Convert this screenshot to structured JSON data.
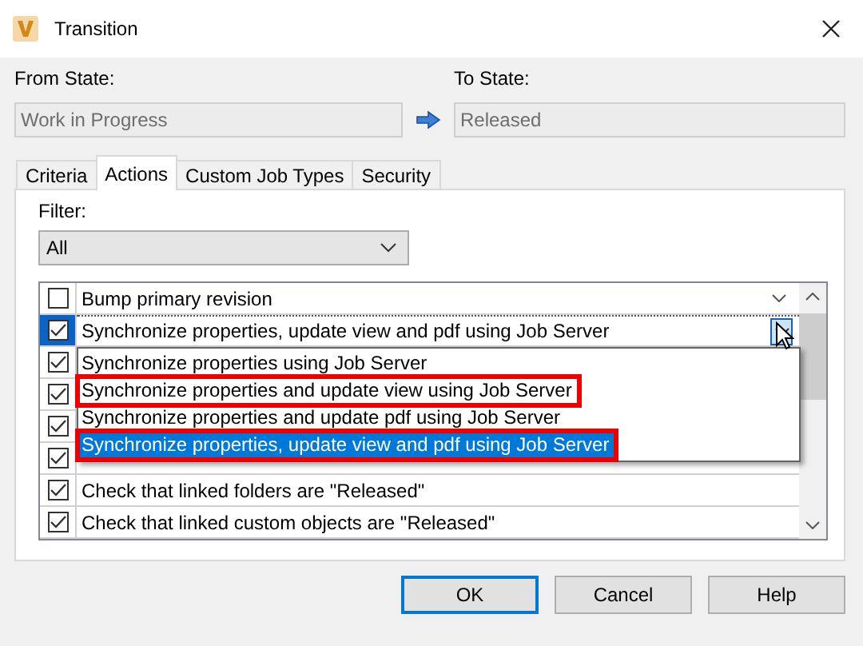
{
  "window": {
    "title": "Transition"
  },
  "from_state": {
    "label": "From State:",
    "value": "Work in Progress"
  },
  "to_state": {
    "label": "To State:",
    "value": "Released"
  },
  "tabs": [
    {
      "label": "Criteria",
      "selected": false
    },
    {
      "label": "Actions",
      "selected": true
    },
    {
      "label": "Custom Job Types",
      "selected": false
    },
    {
      "label": "Security",
      "selected": false
    }
  ],
  "filter": {
    "label": "Filter:",
    "value": "All"
  },
  "actions": [
    {
      "kind": "combo",
      "checked": false,
      "focused": false,
      "label": "Bump primary revision"
    },
    {
      "kind": "combo",
      "checked": true,
      "focused": true,
      "label": "Synchronize properties, update view and pdf using Job Server"
    },
    {
      "kind": "plain",
      "checked": true
    },
    {
      "kind": "plain",
      "checked": true
    },
    {
      "kind": "plain",
      "checked": true
    },
    {
      "kind": "plain",
      "checked": true
    },
    {
      "kind": "plain",
      "checked": true,
      "label": "Check that linked folders are \"Released\""
    },
    {
      "kind": "plain",
      "checked": true,
      "label": "Check that linked custom objects are \"Released\""
    }
  ],
  "dropdown_options": [
    {
      "label": "Synchronize properties using Job Server",
      "selected": false,
      "highlighted": false
    },
    {
      "label": "Synchronize properties and update view using Job Server",
      "selected": false,
      "highlighted": true
    },
    {
      "label": "Synchronize properties and update pdf using Job Server",
      "selected": false,
      "highlighted": false
    },
    {
      "label": "Synchronize properties, update view and pdf using Job Server",
      "selected": true,
      "highlighted": true
    }
  ],
  "buttons": [
    {
      "label": "OK",
      "kind": "default"
    },
    {
      "label": "Cancel",
      "kind": "normal"
    },
    {
      "label": "Help",
      "kind": "normal"
    }
  ]
}
